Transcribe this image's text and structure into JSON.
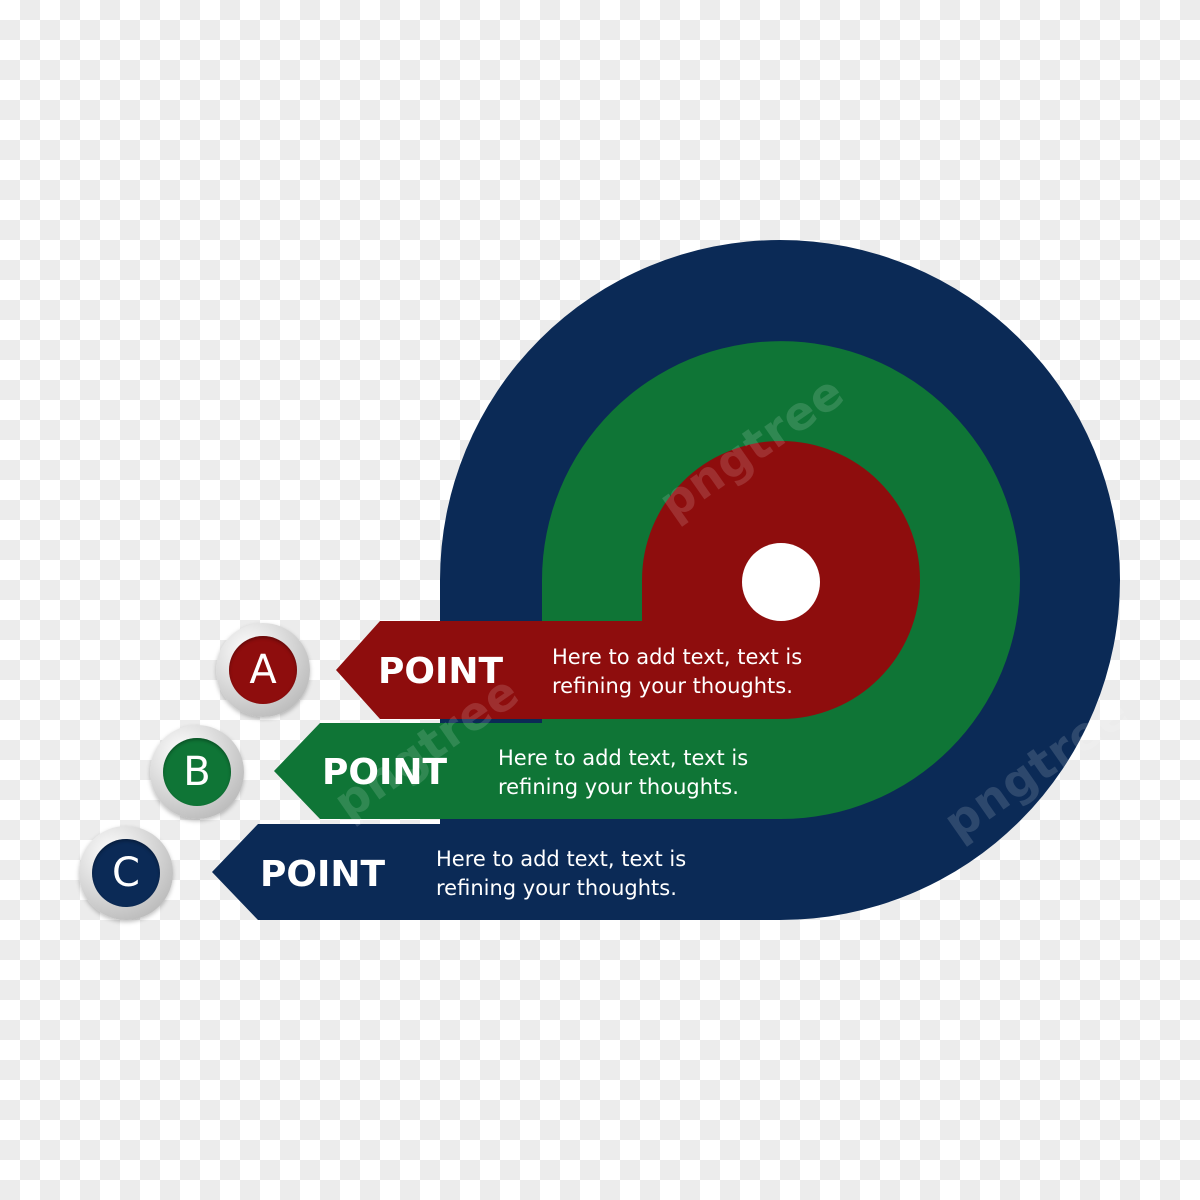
{
  "colors": {
    "blue": "#0b2a56",
    "green": "#0f7536",
    "red": "#8e0d0d",
    "center": "#ffffff"
  },
  "watermark": "pngtree",
  "items": [
    {
      "letter": "A",
      "title": "POINT",
      "text_line1": "Here to add text, text is",
      "text_line2": "refining your thoughts.",
      "color": "red"
    },
    {
      "letter": "B",
      "title": "POINT",
      "text_line1": "Here to add text, text is",
      "text_line2": "refining your thoughts.",
      "color": "green"
    },
    {
      "letter": "C",
      "title": "POINT",
      "text_line1": "Here to add text, text is",
      "text_line2": "refining your thoughts.",
      "color": "blue"
    }
  ]
}
